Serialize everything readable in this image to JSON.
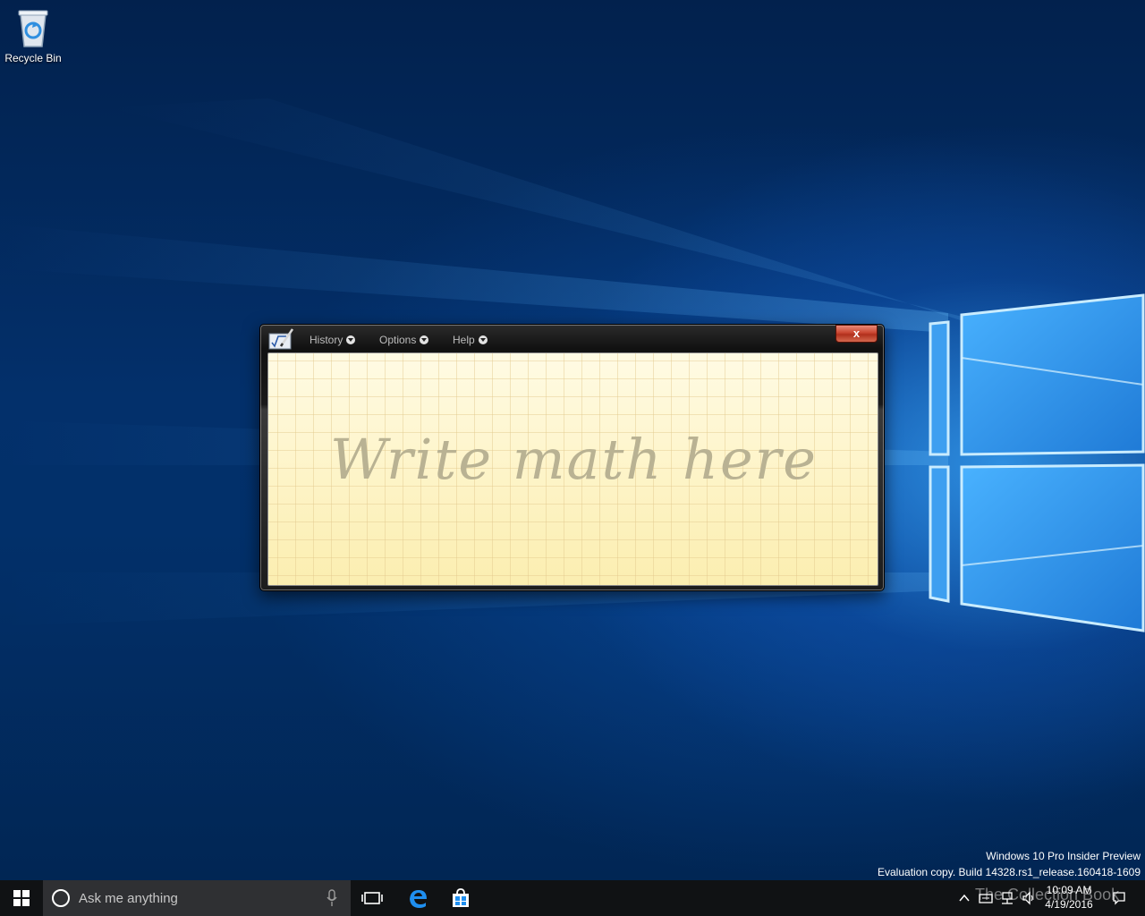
{
  "desktop": {
    "icons": [
      {
        "label": "Recycle Bin",
        "icon": "recycle-bin-icon"
      }
    ],
    "watermark": {
      "line1": "Windows 10 Pro Insider Preview",
      "line2": "Evaluation copy. Build 14328.rs1_release.160418-1609"
    }
  },
  "math_window": {
    "menu": [
      {
        "label": "History"
      },
      {
        "label": "Options"
      },
      {
        "label": "Help"
      }
    ],
    "close_label": "x",
    "placeholder": "Write math here",
    "colors": {
      "paper": "#fdf6cc",
      "placeholder_text": "#b9b293",
      "close_button": "#c94530"
    }
  },
  "taskbar": {
    "search_placeholder": "Ask me anything",
    "pinned": [
      "task-view-icon",
      "edge-icon",
      "store-icon"
    ],
    "tray": [
      "chevron-up-icon",
      "network-icon",
      "volume-icon",
      "action-center-icon"
    ],
    "time": "10:09 AM",
    "date": "4/19/2016",
    "brand_overlay": "The Collection Book"
  }
}
